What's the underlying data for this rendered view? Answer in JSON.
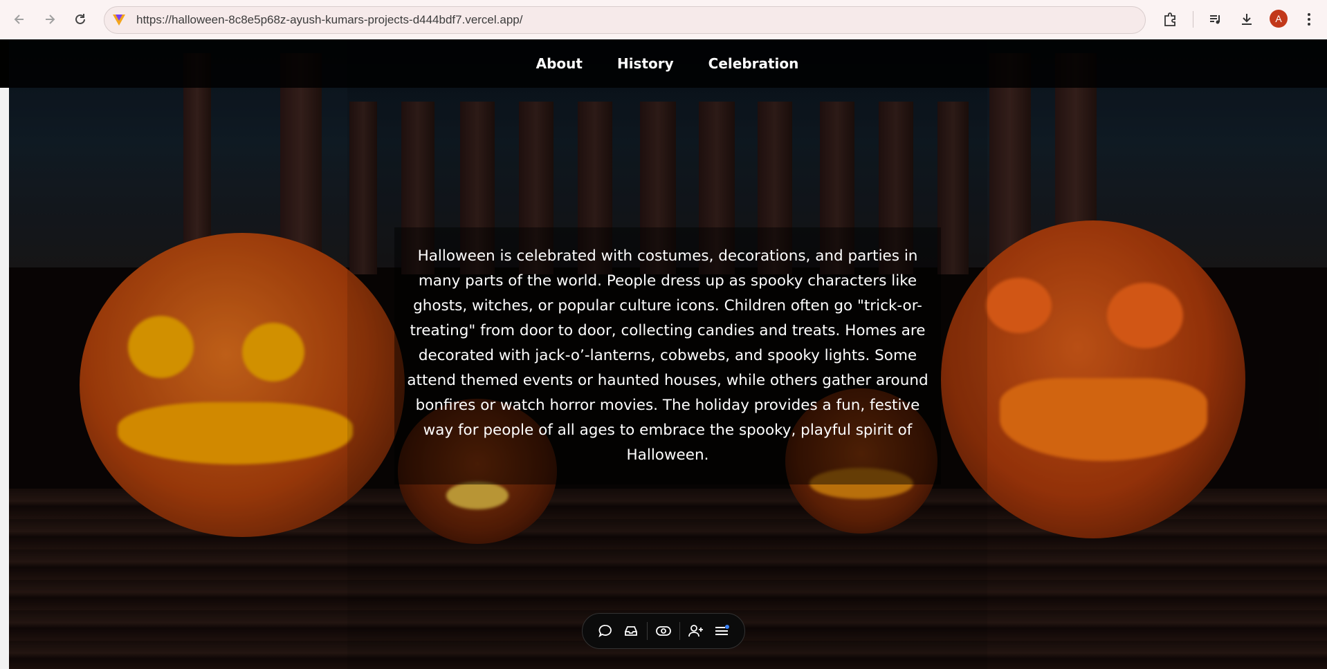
{
  "browser": {
    "url": "https://halloween-8c8e5p68z-ayush-kumars-projects-d444bdf7.vercel.app/",
    "profile_initial": "A",
    "icons": [
      "back-icon",
      "forward-icon",
      "reload-icon",
      "site-logo-icon",
      "extensions-icon",
      "media-control-icon",
      "download-icon",
      "menu-kebab-icon"
    ]
  },
  "nav": {
    "items": [
      {
        "label": "About"
      },
      {
        "label": "History"
      },
      {
        "label": "Celebration"
      }
    ]
  },
  "content": {
    "text": "Halloween is celebrated with costumes, decorations, and parties in many parts of the world. People dress up as spooky characters like ghosts, witches, or popular culture icons. Children often go \"trick-or-treating\" from door to door, collecting candies and treats. Homes are decorated with jack-o’-lanterns, cobwebs, and spooky lights. Some attend themed events or haunted houses, while others gather around bonfires or watch horror movies. The holiday provides a fun, festive way for people of all ages to embrace the spooky, playful spirit of Halloween."
  },
  "toolbar": {
    "icons": [
      "comment-icon",
      "inbox-icon",
      "eye-preview-icon",
      "add-user-icon",
      "menu-notification-icon"
    ]
  },
  "colors": {
    "chrome_bg": "#fbf3f3",
    "avatar": "#c2381a",
    "pumpkin": "#d2560f",
    "glow": "#ffb000"
  }
}
